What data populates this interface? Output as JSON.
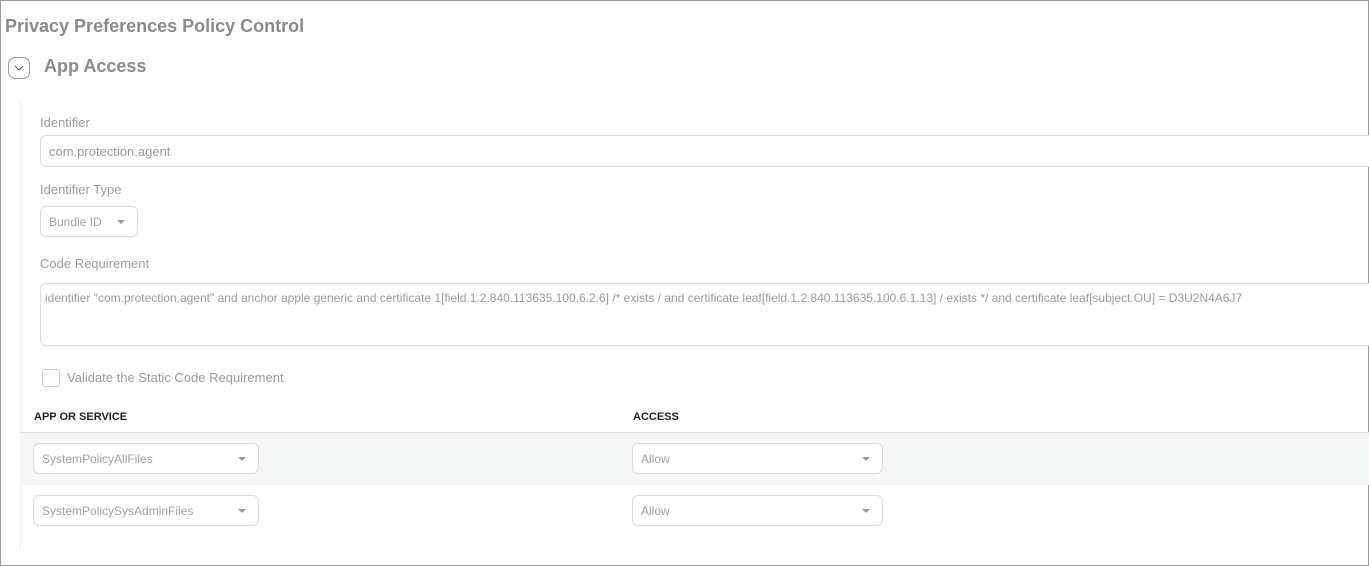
{
  "page_title": "Privacy Preferences Policy Control",
  "section": {
    "title": "App Access",
    "toggle_icon": "chevron-down-icon"
  },
  "identifier": {
    "label": "Identifier",
    "value": "com.protection.agent"
  },
  "identifier_type": {
    "label": "Identifier Type",
    "value": "Bundle ID"
  },
  "code_requirement": {
    "label": "Code Requirement",
    "value": "identifier \"com.protection.agent\" and anchor apple generic and certificate 1[field.1.2.840.113635.100.6.2.6] /* exists / and certificate leaf[field.1.2.840.113635.100.6.1.13] / exists */ and certificate leaf[subject.OU] = D3U2N4A6J7"
  },
  "validate": {
    "label": "Validate the Static Code Requirement",
    "checked": false
  },
  "table": {
    "headers": [
      "APP OR SERVICE",
      "ACCESS"
    ],
    "rows": [
      {
        "service": "SystemPolicyAllFiles",
        "access": "Allow"
      },
      {
        "service": "SystemPolicySysAdminFiles",
        "access": "Allow"
      }
    ]
  }
}
